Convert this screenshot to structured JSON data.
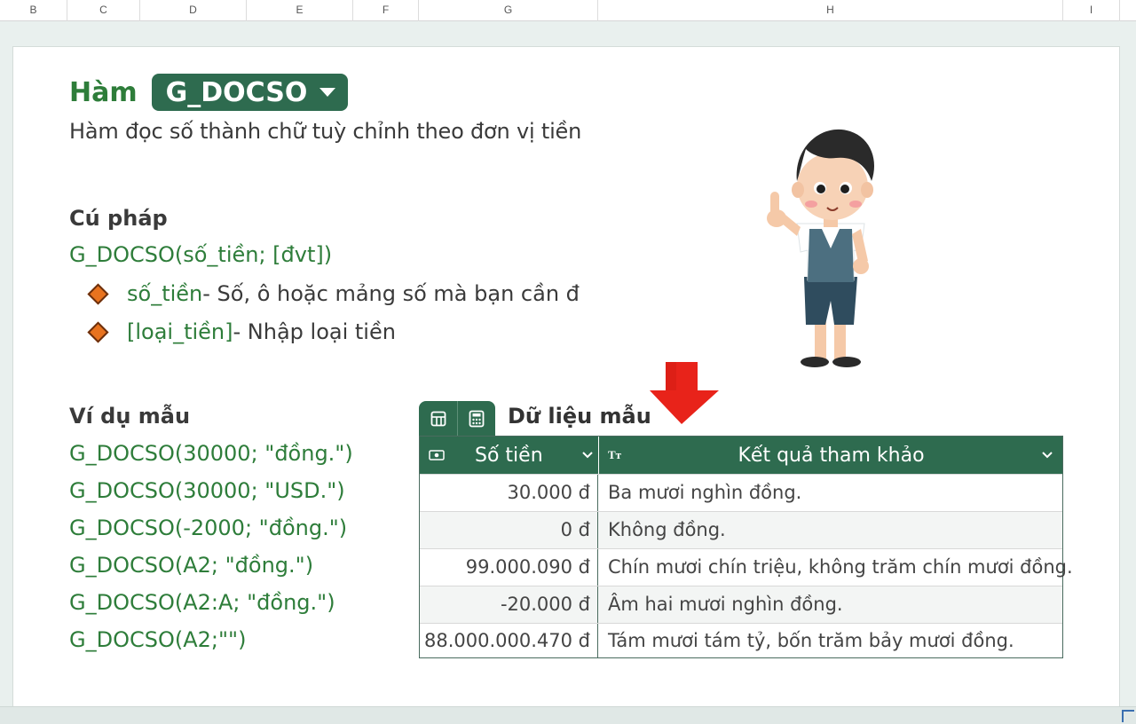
{
  "columns": [
    "B",
    "C",
    "D",
    "E",
    "F",
    "G",
    "H",
    "I"
  ],
  "title": {
    "prefix": "Hàm",
    "function_name": "G_DOCSO"
  },
  "description": "Hàm đọc số thành chữ tuỳ chỉnh theo đơn vị tiền",
  "syntax": {
    "heading": "Cú pháp",
    "formula": "G_DOCSO(số_tiền; [đvt])",
    "args": [
      {
        "name": "số_tiền",
        "desc": " - Số, ô hoặc mảng số mà bạn cần đ"
      },
      {
        "name": "[loại_tiền]",
        "desc": " - Nhập loại tiền"
      }
    ]
  },
  "examples": {
    "heading": "Ví dụ mẫu",
    "items": [
      "G_DOCSO(30000; \"đồng.\")",
      "G_DOCSO(30000; \"USD.\")",
      "G_DOCSO(-2000; \"đồng.\")",
      "G_DOCSO(A2; \"đồng.\")",
      "G_DOCSO(A2:A; \"đồng.\")",
      "G_DOCSO(A2;\"\")"
    ]
  },
  "sample_table": {
    "title": "Dữ liệu mẫu",
    "headers": [
      "Số tiền",
      "Kết quả tham khảo"
    ],
    "rows": [
      [
        "30.000 đ",
        "Ba mươi nghìn đồng."
      ],
      [
        "0 đ",
        "Không đồng."
      ],
      [
        "99.000.090 đ",
        "Chín mươi chín triệu, không trăm chín mươi đồng."
      ],
      [
        "-20.000 đ",
        "Âm hai mươi nghìn đồng."
      ],
      [
        "88.000.000.470 đ",
        "Tám mươi tám tỷ, bốn trăm bảy mươi đồng."
      ]
    ]
  },
  "icons": {
    "dropdown": "chevron-down-icon",
    "table_view": "table-icon",
    "calculator": "calculator-icon",
    "currency": "banknote-icon",
    "text_type": "text-type-icon",
    "arrow": "red-down-arrow-icon"
  },
  "colors": {
    "accent_green": "#2e7d3a",
    "header_green": "#2e6b4f",
    "bullet_orange": "#e8731f",
    "arrow_red": "#e8231a"
  }
}
